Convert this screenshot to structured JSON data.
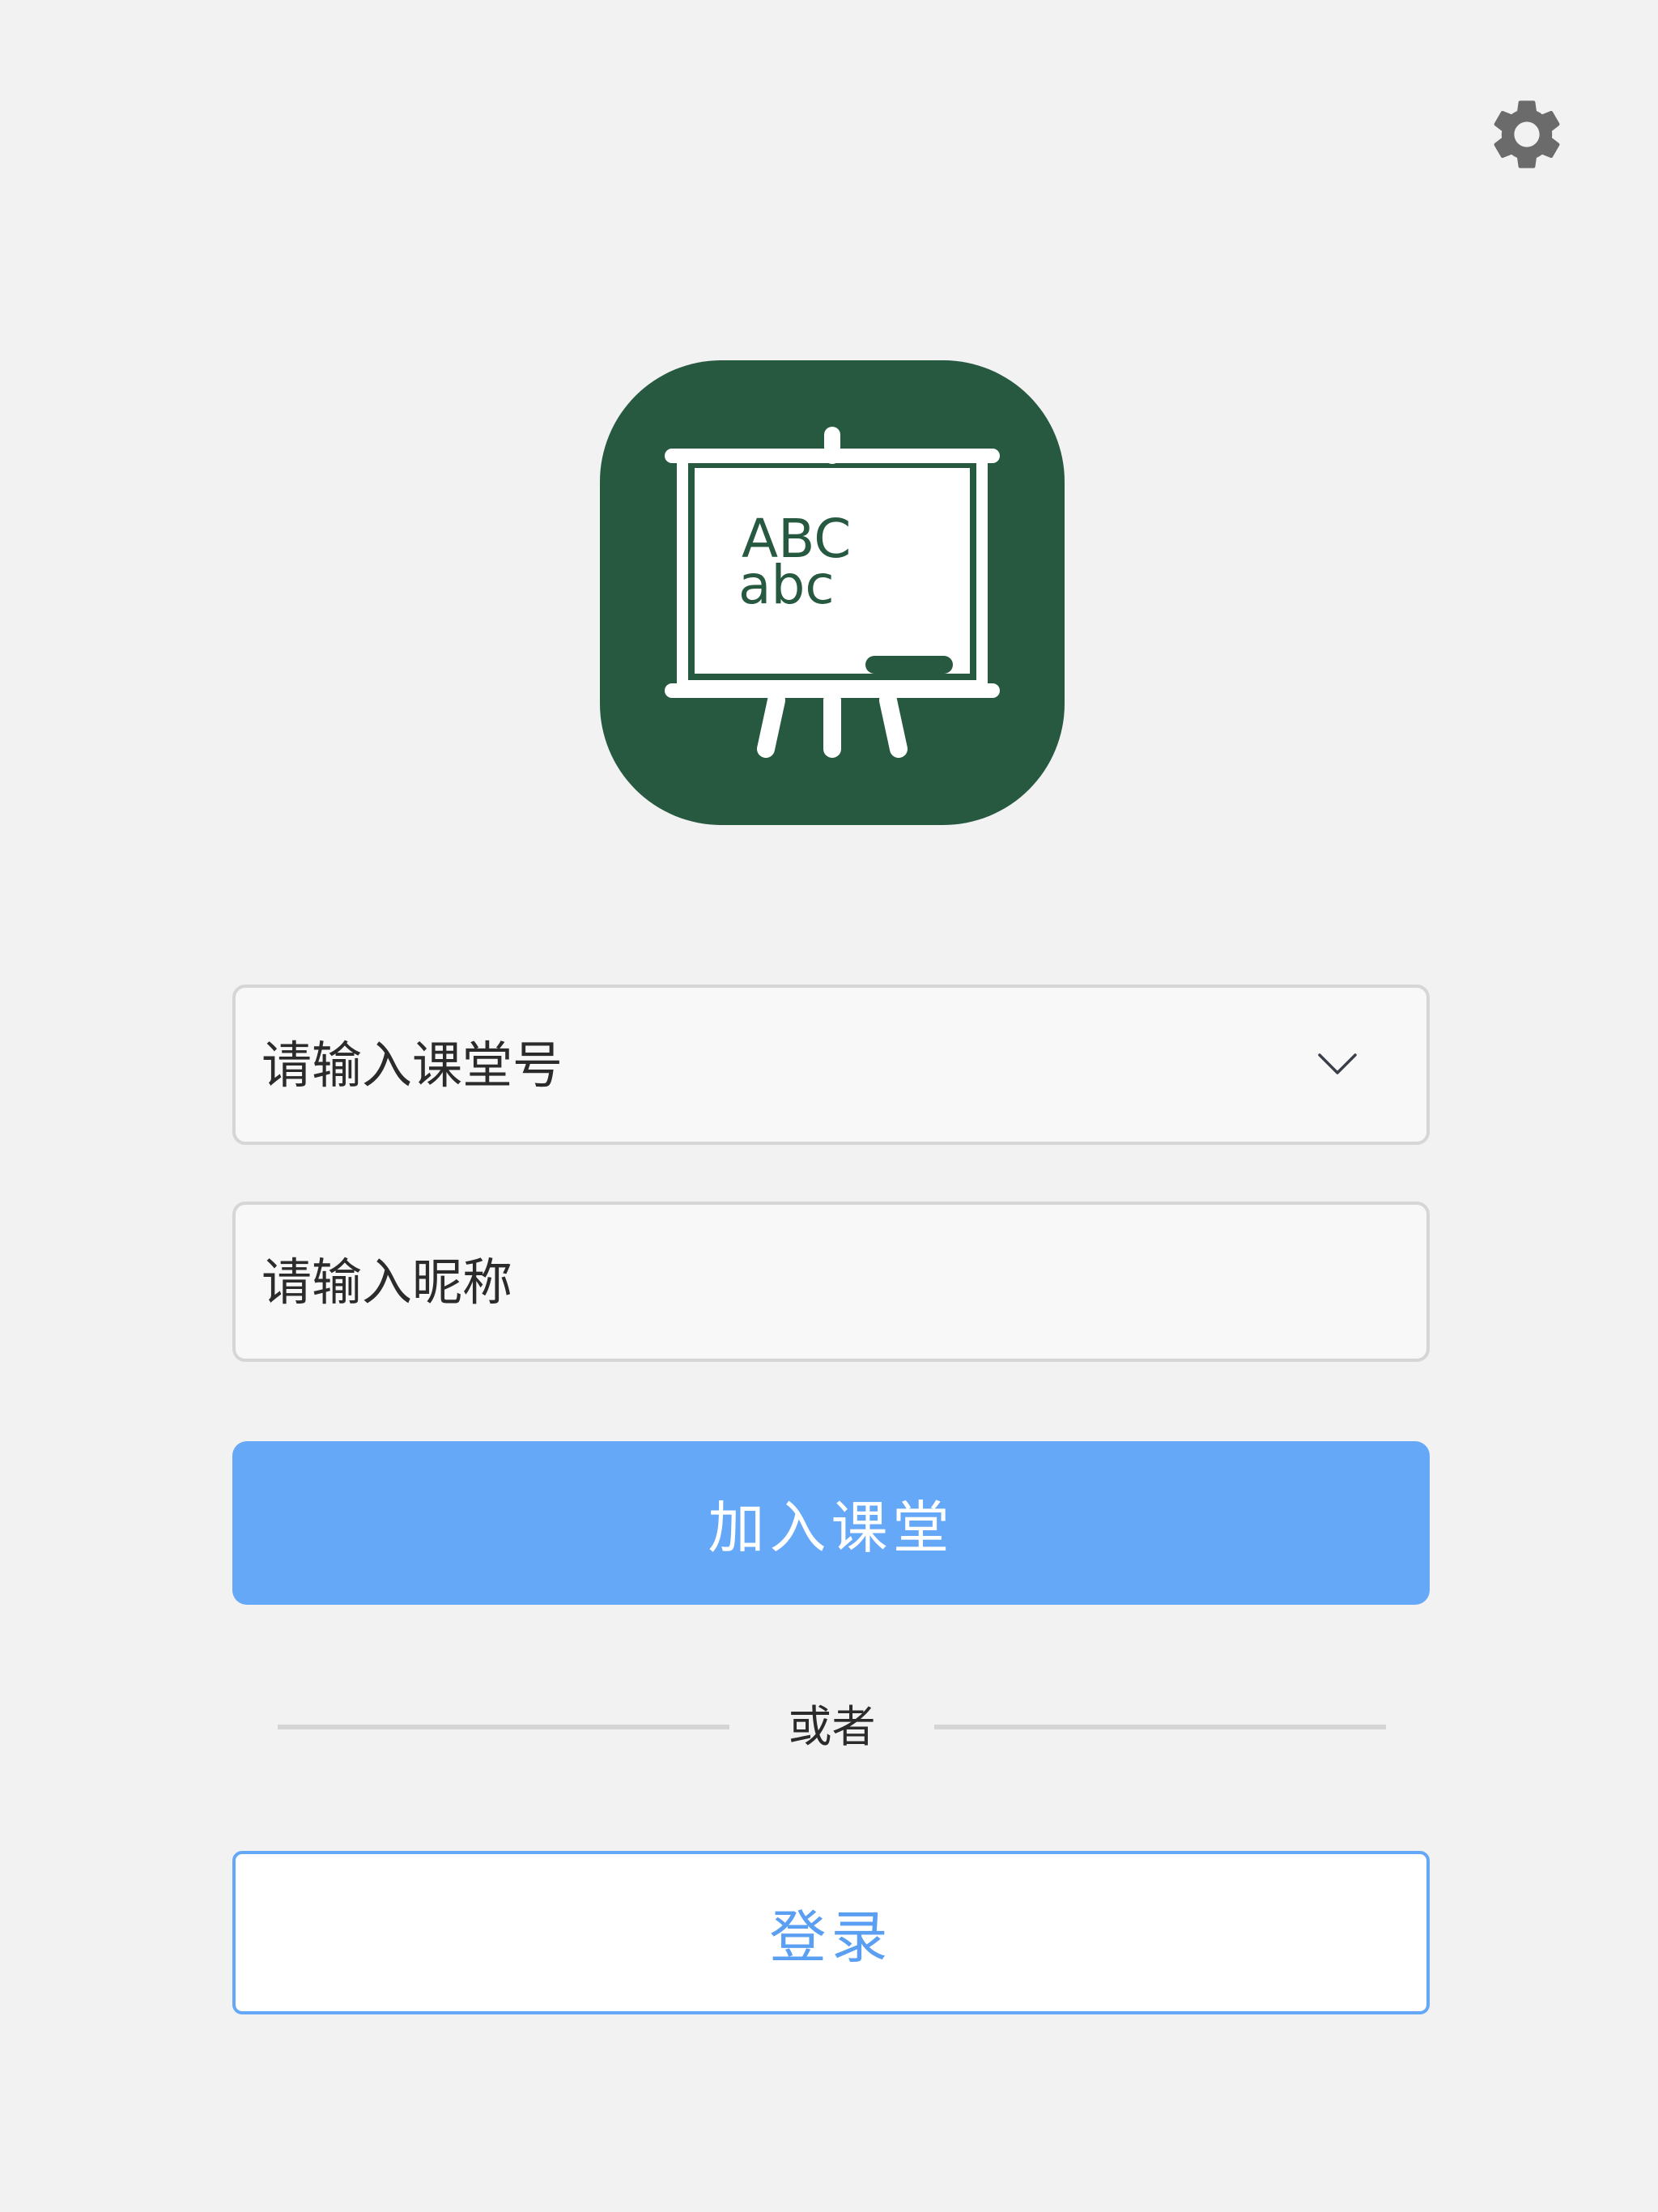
{
  "header": {
    "settings_icon": "gear-icon"
  },
  "logo": {
    "icon": "easel-whiteboard-icon",
    "board_upper": "ABC",
    "board_lower": "abc",
    "background_color": "#275941"
  },
  "form": {
    "class_number": {
      "placeholder": "请输入课堂号",
      "value": "",
      "dropdown_icon": "chevron-down-icon"
    },
    "nickname": {
      "placeholder": "请输入昵称",
      "value": ""
    },
    "join_label": "加入课堂",
    "divider_text": "或者",
    "login_label": "登录"
  },
  "colors": {
    "accent": "#66a8f8",
    "background": "#f2f2f2",
    "logo_green": "#275941"
  }
}
